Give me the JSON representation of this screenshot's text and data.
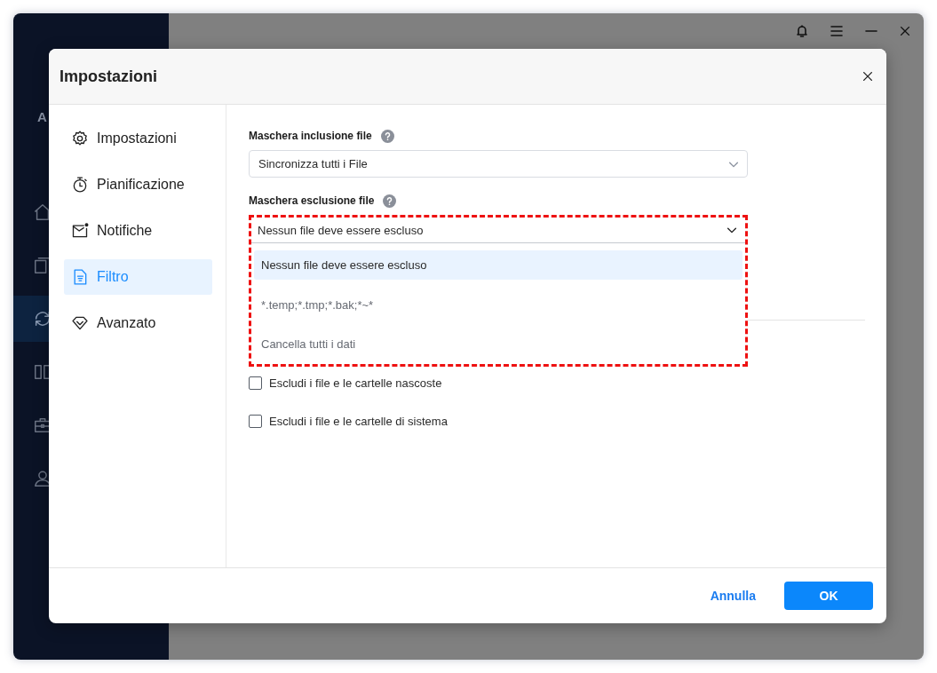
{
  "app": {
    "brand": "A",
    "nav": [
      {
        "kind": "home",
        "selected": false
      },
      {
        "kind": "copy",
        "selected": false
      },
      {
        "kind": "sync",
        "selected": true
      },
      {
        "kind": "columns",
        "selected": false
      },
      {
        "kind": "tools",
        "selected": false
      },
      {
        "kind": "user",
        "selected": false
      }
    ]
  },
  "dialog": {
    "title": "Impostazioni",
    "nav": [
      {
        "label": "Impostazioni",
        "kind": "gear",
        "selected": false
      },
      {
        "label": "Pianificazione",
        "kind": "timer",
        "selected": false
      },
      {
        "label": "Notifiche",
        "kind": "mail",
        "selected": false
      },
      {
        "label": "Filtro",
        "kind": "filter",
        "selected": true
      },
      {
        "label": "Avanzato",
        "kind": "diamond",
        "selected": false
      }
    ],
    "inclusion": {
      "label": "Maschera inclusione file",
      "value": "Sincronizza tutti i File"
    },
    "exclusion": {
      "label": "Maschera esclusione file",
      "value": "Nessun file deve essere escluso",
      "expanded": true,
      "highlighted": true,
      "options": [
        {
          "label": "Nessun file deve essere escluso",
          "selected": true
        },
        {
          "label": "*.temp;*.tmp;*.bak;*~*",
          "selected": false
        },
        {
          "label": "Cancella tutti i dati",
          "selected": false
        }
      ]
    },
    "checkboxes": [
      {
        "label": "Escludi i file e le cartelle nascoste",
        "checked": false
      },
      {
        "label": "Escludi i file e le cartelle di sistema",
        "checked": false
      }
    ],
    "buttons": [
      {
        "label": "Annulla",
        "kind": "link"
      },
      {
        "label": "OK",
        "kind": "primary"
      }
    ]
  }
}
